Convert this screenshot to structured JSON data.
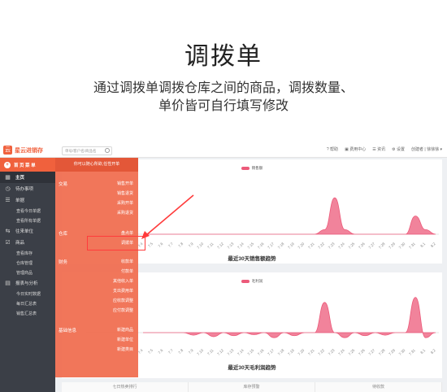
{
  "hero": {
    "title": "调拨单",
    "desc_line1": "通过调拨单调拨仓库之间的商品，调拨数量、",
    "desc_line2": "单价皆可自行填写修改"
  },
  "topbar": {
    "logo_text": "星云进销存",
    "search_placeholder": "单号/客户名/商品名",
    "help": "帮助",
    "service": "费用中心",
    "news": "资讯",
    "settings": "设置",
    "user_role": "创建者",
    "user_name": "徐徐徐"
  },
  "sidebar": {
    "header": "首 页 菜 单",
    "items": [
      {
        "label": "主页",
        "icon": "grid-icon"
      },
      {
        "label": "待办事项",
        "icon": "clock-icon"
      },
      {
        "label": "单据",
        "icon": "list-icon"
      },
      {
        "label": "查看今日单据"
      },
      {
        "label": "查看所有单据"
      },
      {
        "label": "往来单位",
        "icon": "exchange-icon"
      },
      {
        "label": "商品",
        "icon": "box-icon"
      },
      {
        "label": "查看库存"
      },
      {
        "label": "仓库管理"
      },
      {
        "label": "管理商品"
      },
      {
        "label": "报表与分析",
        "icon": "chart-icon"
      },
      {
        "label": "今日实时数据"
      },
      {
        "label": "每日汇总表"
      },
      {
        "label": "销售汇总表"
      }
    ]
  },
  "mega": {
    "hint": "你可以随心所欲,任性开单",
    "groups": [
      {
        "name": "交易",
        "links": [
          "销售开单",
          "销售退货",
          "采购开单",
          "采购退货"
        ]
      },
      {
        "name": "仓库",
        "links": [
          "盘点单",
          "调拨单"
        ]
      },
      {
        "name": "财务",
        "links": [
          "收款单",
          "付款单",
          "其他收入单",
          "支出费用单",
          "应收款调整",
          "应付款调整"
        ]
      },
      {
        "name": "基础信息",
        "links": [
          "新建商品",
          "新建单位",
          "新建类目"
        ]
      }
    ]
  },
  "charts": {
    "colors": {
      "series": "#ec5a7a",
      "axis": "#cccccc"
    }
  },
  "chart_data": [
    {
      "type": "area",
      "title": "最近30天销售额趋势",
      "series": [
        {
          "name": "销售额",
          "values": [
            0,
            0,
            0,
            0,
            0,
            0,
            0,
            0,
            0,
            0,
            0,
            0,
            0,
            0,
            0,
            0,
            0,
            0,
            1,
            8,
            1,
            0,
            0,
            0,
            0,
            0,
            0,
            4,
            1,
            0
          ]
        }
      ],
      "x": [
        "7.4",
        "7.5",
        "7.6",
        "7.7",
        "7.8",
        "7.9",
        "7.10",
        "7.11",
        "7.12",
        "7.13",
        "7.14",
        "7.15",
        "7.16",
        "7.17",
        "7.18",
        "7.19",
        "7.20",
        "7.21",
        "7.22",
        "7.23",
        "7.24",
        "7.25",
        "7.26",
        "7.27",
        "7.28",
        "7.29",
        "7.30",
        "7.31",
        "8.1",
        "8.2"
      ]
    },
    {
      "type": "area",
      "title": "最近30天毛利润趋势",
      "series": [
        {
          "name": "毛利润",
          "values": [
            0,
            0,
            0,
            0,
            0,
            -0.5,
            0,
            -0.8,
            0,
            -0.6,
            0,
            -0.4,
            0,
            -1,
            0,
            -0.6,
            0,
            0,
            6,
            0,
            -1,
            0,
            -0.6,
            0,
            -0.5,
            0,
            0,
            7,
            -1,
            0
          ]
        }
      ],
      "x": [
        "7.4",
        "7.5",
        "7.6",
        "7.7",
        "7.8",
        "7.9",
        "7.10",
        "7.11",
        "7.12",
        "7.13",
        "7.14",
        "7.15",
        "7.16",
        "7.17",
        "7.18",
        "7.19",
        "7.20",
        "7.21",
        "7.22",
        "7.23",
        "7.24",
        "7.25",
        "7.26",
        "7.27",
        "7.28",
        "7.29",
        "7.30",
        "7.31",
        "8.1",
        "8.2"
      ]
    }
  ],
  "tabs": [
    "七日热卖排行",
    "库存预警",
    "待收款"
  ]
}
